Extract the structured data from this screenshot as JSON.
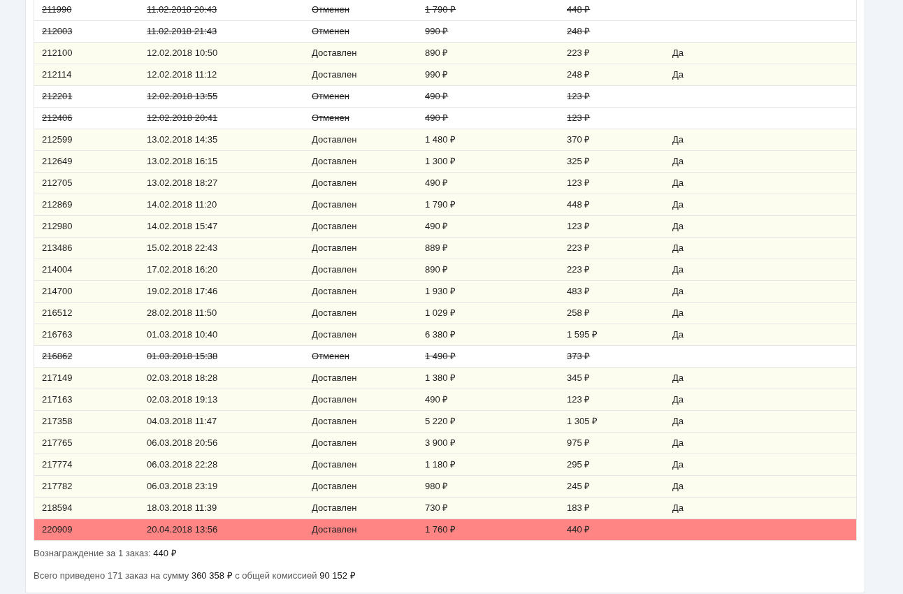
{
  "rows": [
    {
      "kind": "cancelled",
      "id": "211990",
      "date": "11.02.2018 20:43",
      "status": "Отменен",
      "sum": "1 790 ₽",
      "commission": "448 ₽",
      "paid": ""
    },
    {
      "kind": "cancelled",
      "id": "212003",
      "date": "11.02.2018 21:43",
      "status": "Отменен",
      "sum": "990 ₽",
      "commission": "248 ₽",
      "paid": ""
    },
    {
      "kind": "delivered",
      "id": "212100",
      "date": "12.02.2018 10:50",
      "status": "Доставлен",
      "sum": "890 ₽",
      "commission": "223 ₽",
      "paid": "Да"
    },
    {
      "kind": "delivered",
      "id": "212114",
      "date": "12.02.2018 11:12",
      "status": "Доставлен",
      "sum": "990 ₽",
      "commission": "248 ₽",
      "paid": "Да"
    },
    {
      "kind": "cancelled",
      "id": "212201",
      "date": "12.02.2018 13:55",
      "status": "Отменен",
      "sum": "490 ₽",
      "commission": "123 ₽",
      "paid": ""
    },
    {
      "kind": "cancelled",
      "id": "212406",
      "date": "12.02.2018 20:41",
      "status": "Отменен",
      "sum": "490 ₽",
      "commission": "123 ₽",
      "paid": ""
    },
    {
      "kind": "delivered",
      "id": "212599",
      "date": "13.02.2018 14:35",
      "status": "Доставлен",
      "sum": "1 480 ₽",
      "commission": "370 ₽",
      "paid": "Да"
    },
    {
      "kind": "delivered",
      "id": "212649",
      "date": "13.02.2018 16:15",
      "status": "Доставлен",
      "sum": "1 300 ₽",
      "commission": "325 ₽",
      "paid": "Да"
    },
    {
      "kind": "delivered",
      "id": "212705",
      "date": "13.02.2018 18:27",
      "status": "Доставлен",
      "sum": "490 ₽",
      "commission": "123 ₽",
      "paid": "Да"
    },
    {
      "kind": "delivered",
      "id": "212869",
      "date": "14.02.2018 11:20",
      "status": "Доставлен",
      "sum": "1 790 ₽",
      "commission": "448 ₽",
      "paid": "Да"
    },
    {
      "kind": "delivered",
      "id": "212980",
      "date": "14.02.2018 15:47",
      "status": "Доставлен",
      "sum": "490 ₽",
      "commission": "123 ₽",
      "paid": "Да"
    },
    {
      "kind": "delivered",
      "id": "213486",
      "date": "15.02.2018 22:43",
      "status": "Доставлен",
      "sum": "889 ₽",
      "commission": "223 ₽",
      "paid": "Да"
    },
    {
      "kind": "delivered",
      "id": "214004",
      "date": "17.02.2018 16:20",
      "status": "Доставлен",
      "sum": "890 ₽",
      "commission": "223 ₽",
      "paid": "Да"
    },
    {
      "kind": "delivered",
      "id": "214700",
      "date": "19.02.2018 17:46",
      "status": "Доставлен",
      "sum": "1 930 ₽",
      "commission": "483 ₽",
      "paid": "Да"
    },
    {
      "kind": "delivered",
      "id": "216512",
      "date": "28.02.2018 11:50",
      "status": "Доставлен",
      "sum": "1 029 ₽",
      "commission": "258 ₽",
      "paid": "Да"
    },
    {
      "kind": "delivered",
      "id": "216763",
      "date": "01.03.2018 10:40",
      "status": "Доставлен",
      "sum": "6 380 ₽",
      "commission": "1 595 ₽",
      "paid": "Да"
    },
    {
      "kind": "cancelled",
      "id": "216862",
      "date": "01.03.2018 15:38",
      "status": "Отменен",
      "sum": "1 490 ₽",
      "commission": "373 ₽",
      "paid": ""
    },
    {
      "kind": "delivered",
      "id": "217149",
      "date": "02.03.2018 18:28",
      "status": "Доставлен",
      "sum": "1 380 ₽",
      "commission": "345 ₽",
      "paid": "Да"
    },
    {
      "kind": "delivered",
      "id": "217163",
      "date": "02.03.2018 19:13",
      "status": "Доставлен",
      "sum": "490 ₽",
      "commission": "123 ₽",
      "paid": "Да"
    },
    {
      "kind": "delivered",
      "id": "217358",
      "date": "04.03.2018 11:47",
      "status": "Доставлен",
      "sum": "5 220 ₽",
      "commission": "1 305 ₽",
      "paid": "Да"
    },
    {
      "kind": "delivered",
      "id": "217765",
      "date": "06.03.2018 20:56",
      "status": "Доставлен",
      "sum": "3 900 ₽",
      "commission": "975 ₽",
      "paid": "Да"
    },
    {
      "kind": "delivered",
      "id": "217774",
      "date": "06.03.2018 22:28",
      "status": "Доставлен",
      "sum": "1 180 ₽",
      "commission": "295 ₽",
      "paid": "Да"
    },
    {
      "kind": "delivered",
      "id": "217782",
      "date": "06.03.2018 23:19",
      "status": "Доставлен",
      "sum": "980 ₽",
      "commission": "245 ₽",
      "paid": "Да"
    },
    {
      "kind": "delivered",
      "id": "218594",
      "date": "18.03.2018 11:39",
      "status": "Доставлен",
      "sum": "730 ₽",
      "commission": "183 ₽",
      "paid": "Да"
    },
    {
      "kind": "highlighted",
      "id": "220909",
      "date": "20.04.2018 13:56",
      "status": "Доставлен",
      "sum": "1 760 ₽",
      "commission": "440 ₽",
      "paid": ""
    }
  ],
  "reward_note": "Вознаграждение за 1 заказ: **440 ₽**",
  "summary": "Всего приведено 171 заказ на сумму **360 358 ₽** с общей комиссией **90 152 ₽**"
}
